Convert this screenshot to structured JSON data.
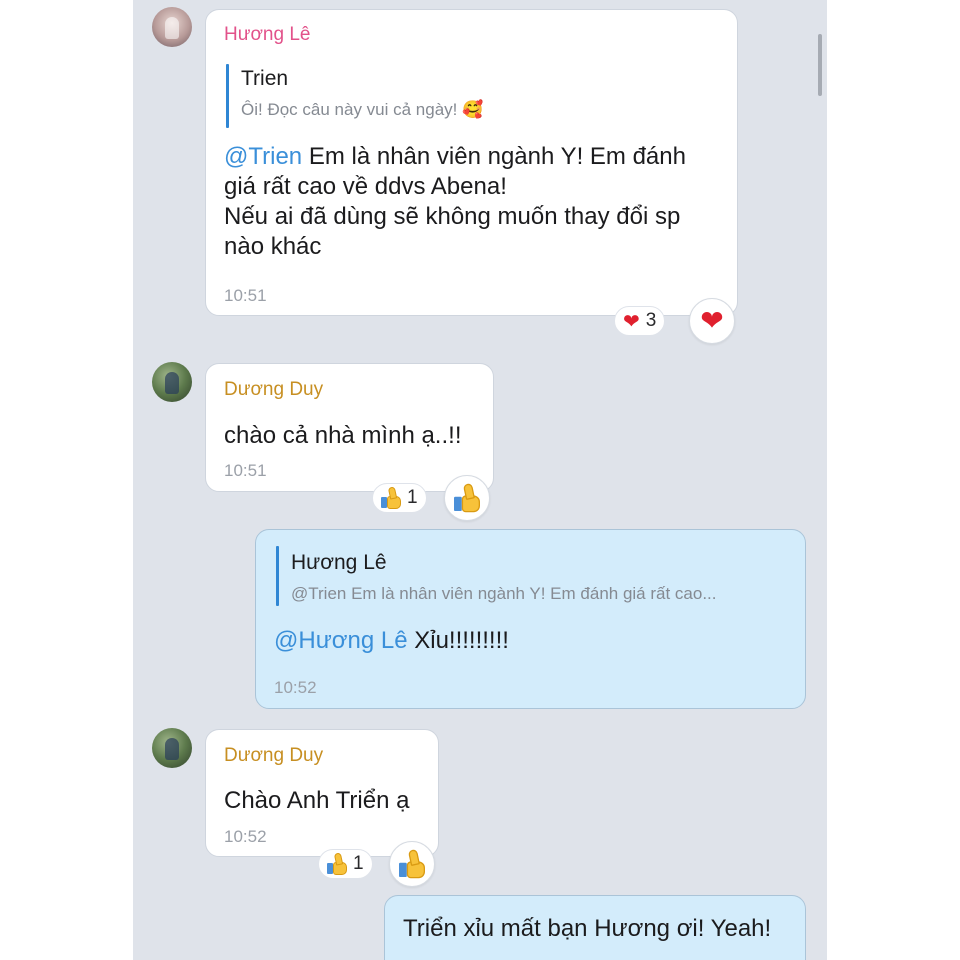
{
  "messages": [
    {
      "sender": "Hương  Lê",
      "quote": {
        "name": "Trien",
        "text": "Ôi! Đọc câu này vui cả ngày! 🥰"
      },
      "mention": "@Trien",
      "text_lines": [
        " Em là nhân viên ngành Y! Em đánh",
        "giá rất cao về ddvs Abena!",
        "Nếu ai đã dùng sẽ không muốn thay đổi sp",
        "nào khác"
      ],
      "time": "10:51",
      "reaction": {
        "icon": "heart",
        "count": "3"
      }
    },
    {
      "sender": "Dương Duy",
      "text": "chào cả nhà mình ạ..!!",
      "time": "10:51",
      "reaction": {
        "icon": "thumbs-up",
        "count": "1"
      }
    },
    {
      "outgoing": true,
      "quote": {
        "name": "Hương  Lê",
        "text": "@Trien Em là nhân viên ngành Y! Em đánh giá rất cao..."
      },
      "mention": "@Hương  Lê",
      "text": " Xỉu!!!!!!!!!",
      "time": "10:52"
    },
    {
      "sender": "Dương Duy",
      "text": "Chào Anh Triển ạ",
      "time": "10:52",
      "reaction": {
        "icon": "thumbs-up",
        "count": "1"
      }
    },
    {
      "outgoing": true,
      "text": "Triển xỉu mất bạn Hương ơi! Yeah!"
    }
  ],
  "colors": {
    "background": "#dfe3ea",
    "incoming_bubble": "#ffffff",
    "outgoing_bubble": "#d3ecfb",
    "mention": "#3a8fd9",
    "sender_huong": "#e2528a",
    "sender_duy": "#c78f22"
  }
}
